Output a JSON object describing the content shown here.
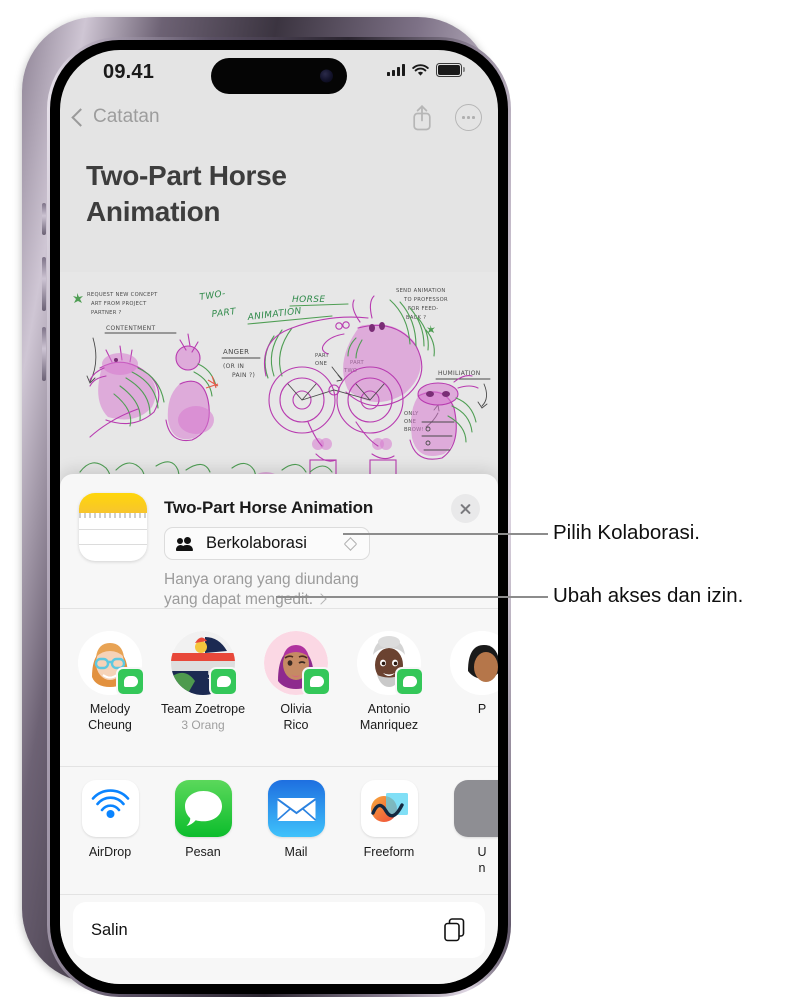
{
  "phone": {
    "status_bar": {
      "time": "09.41",
      "cellular": "signal-bars-icon",
      "wifi": "wifi-icon",
      "battery": "battery-full-icon"
    },
    "nav_bar": {
      "back_label": "Catatan",
      "share_icon": "share-icon",
      "more_icon": "more-circle-icon"
    },
    "note": {
      "title": "Two-Part Horse\nAnimation",
      "title_line1": "Two-Part Horse",
      "title_line2": "Animation"
    }
  },
  "share_sheet": {
    "app_icon": "notes-app-icon",
    "document_title": "Two-Part Horse Animation",
    "close_icon": "close-icon",
    "collaborate": {
      "icon": "people-icon",
      "label": "Berkolaborasi",
      "chevron": "up-down-chevron-icon"
    },
    "permission_text": "Hanya orang yang diundang yang dapat mengedit.",
    "permission_chevron": "chevron-right-icon",
    "contacts": [
      {
        "name_line1": "Melody",
        "name_line2": "Cheung",
        "subtitle": "",
        "badge": "messages-badge-icon"
      },
      {
        "name_line1": "Team Zoetrope",
        "name_line2": "",
        "subtitle": "3 Orang",
        "badge": "messages-badge-icon"
      },
      {
        "name_line1": "Olivia",
        "name_line2": "Rico",
        "subtitle": "",
        "badge": "messages-badge-icon"
      },
      {
        "name_line1": "Antonio",
        "name_line2": "Manriquez",
        "subtitle": "",
        "badge": "messages-badge-icon"
      },
      {
        "name_line1": "P",
        "name_line2": "",
        "subtitle": "",
        "badge": ""
      }
    ],
    "apps": [
      {
        "label": "AirDrop",
        "icon": "airdrop-icon"
      },
      {
        "label": "Pesan",
        "icon": "messages-icon"
      },
      {
        "label": "Mail",
        "icon": "mail-icon"
      },
      {
        "label": "Freeform",
        "icon": "freeform-icon"
      },
      {
        "label": "U\nn",
        "icon": "more-apps-icon"
      }
    ],
    "actions": [
      {
        "label": "Salin",
        "icon": "copy-icon"
      }
    ]
  },
  "annotations": [
    {
      "text": "Pilih Kolaborasi."
    },
    {
      "text": "Ubah akses dan izin."
    }
  ],
  "colors": {
    "notes_yellow": "#ffd60a",
    "messages_green": "#34c759",
    "mail_blue": "#1d90f5",
    "airdrop_blue": "#007aff",
    "screen_bg": "#e4e4e4",
    "sheet_bg": "#f7f7f7"
  }
}
